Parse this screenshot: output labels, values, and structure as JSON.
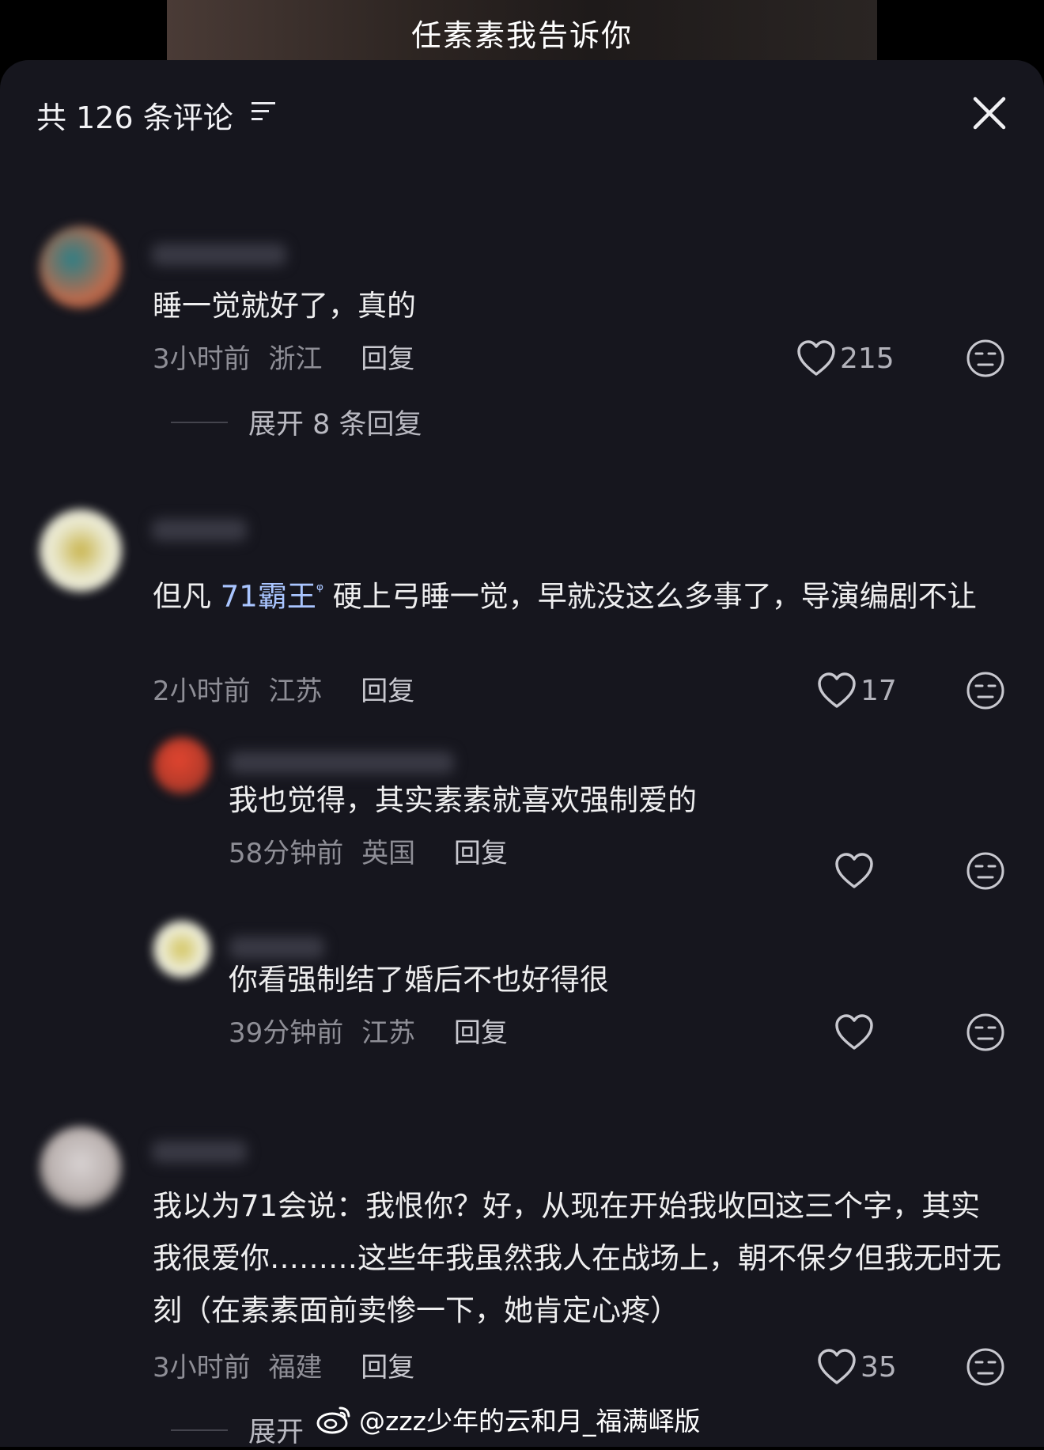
{
  "video": {
    "subtitle": "任素素我告诉你"
  },
  "header": {
    "title": "共 126 条评论",
    "filter_icon": "filter-icon",
    "close_icon": "close-icon"
  },
  "comments": [
    {
      "text": "睡一觉就好了，真的",
      "time": "3小时前",
      "location": "浙江",
      "reply_label": "回复",
      "likes": "215",
      "expand_label": "展开 8 条回复"
    },
    {
      "text_before": "但凡 ",
      "mention": "71霸王",
      "text_after": " 硬上弓睡一觉，早就没这么多事了，导演编剧不让",
      "time": "2小时前",
      "location": "江苏",
      "reply_label": "回复",
      "likes": "17",
      "replies": [
        {
          "text": "我也觉得，其实素素就喜欢强制爱的",
          "time": "58分钟前",
          "location": "英国",
          "reply_label": "回复"
        },
        {
          "text": "你看强制结了婚后不也好得很",
          "time": "39分钟前",
          "location": "江苏",
          "reply_label": "回复"
        }
      ]
    },
    {
      "text": "我以为71会说：我恨你？好，从现在开始我收回这三个字，其实我很爱你………这些年我虽然我人在战场上，朝不保夕但我无时无刻（在素素面前卖惨一下，她肯定心疼）",
      "time": "3小时前",
      "location": "福建",
      "reply_label": "回复",
      "likes": "35",
      "expand_label": "展开"
    }
  ],
  "watermark": {
    "text": "@zzz少年的云和月_福满峄版",
    "icon": "weibo-logo-icon"
  }
}
